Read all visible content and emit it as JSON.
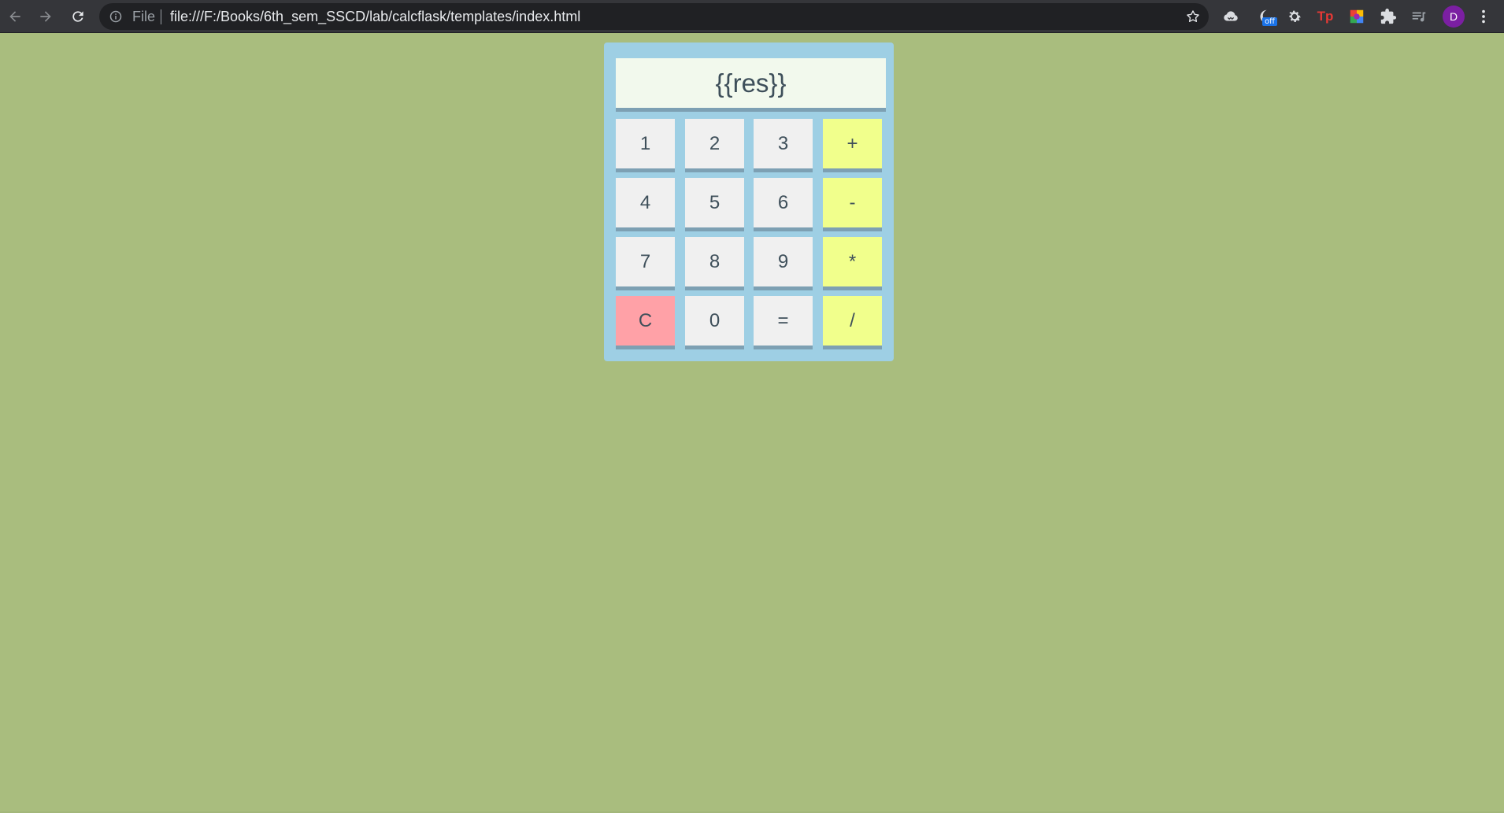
{
  "browser": {
    "scheme_label": "File",
    "url": "file:///F:/Books/6th_sem_SSCD/lab/calcflask/templates/index.html",
    "extension_off_badge": "off",
    "extension_tp_label": "Tp",
    "profile_initial": "D"
  },
  "calculator": {
    "display": "{{res}}",
    "keys": {
      "k1": "1",
      "k2": "2",
      "k3": "3",
      "plus": "+",
      "k4": "4",
      "k5": "5",
      "k6": "6",
      "minus": "-",
      "k7": "7",
      "k8": "8",
      "k9": "9",
      "multiply": "*",
      "clear": "C",
      "k0": "0",
      "equals": "=",
      "divide": "/"
    }
  },
  "colors": {
    "page_background": "#a9bd7e",
    "calculator_background": "#9ecfe4",
    "display_background": "#f2f9ed",
    "digit_key": "#f0f0f0",
    "operator_key": "#f1ff8c",
    "clear_key": "#ffa1a7",
    "key_shadow": "#7da0b3",
    "text": "#3e4f5a"
  }
}
